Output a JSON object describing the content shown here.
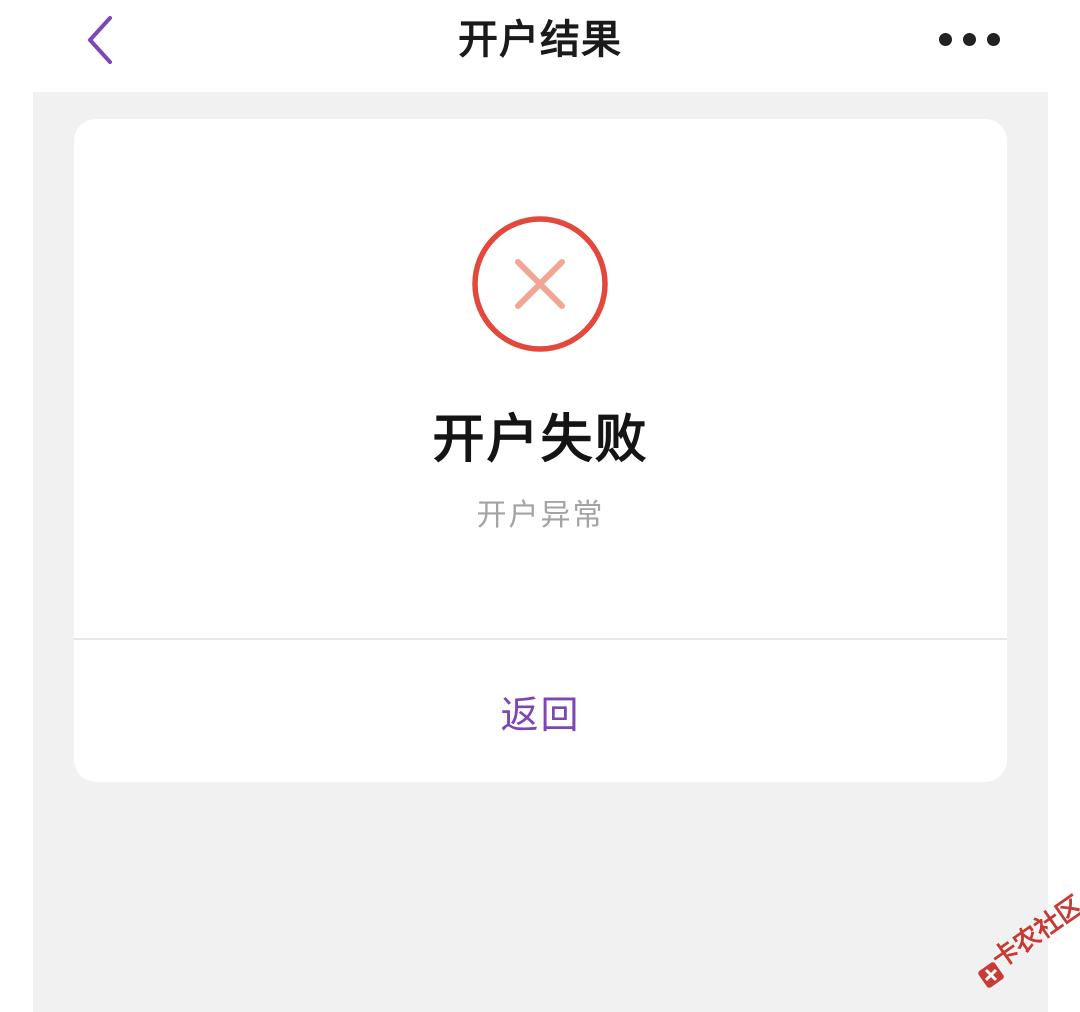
{
  "navbar": {
    "title": "开户结果",
    "back_icon": "chevron-left-icon",
    "more_icon": "more-horizontal-icon"
  },
  "result": {
    "status_icon": "error-circle-x-icon",
    "title": "开户失败",
    "description": "开户异常"
  },
  "actions": {
    "return_label": "返回"
  },
  "watermark": {
    "text": "卡农社区"
  },
  "colors": {
    "accent": "#7d45b5",
    "error_ring": "#e2483c",
    "error_cross": "#f0a595",
    "page_background": "#f1f1f1",
    "card_background": "#ffffff"
  }
}
